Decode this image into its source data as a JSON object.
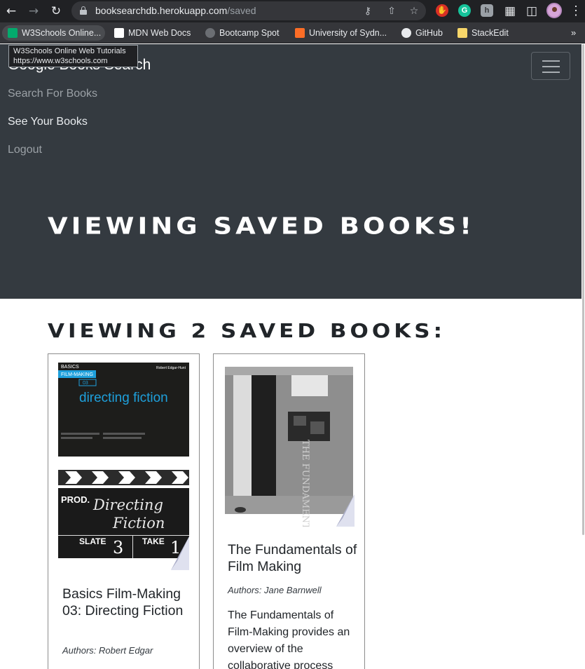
{
  "browser": {
    "url_host": "booksearchdb.herokuapp.com",
    "url_path": "/saved",
    "bookmarks": [
      {
        "label": "W3Schools Online..."
      },
      {
        "label": "MDN Web Docs"
      },
      {
        "label": "Bootcamp Spot"
      },
      {
        "label": "University of Sydn..."
      },
      {
        "label": "GitHub"
      },
      {
        "label": "StackEdit"
      }
    ],
    "tooltip": {
      "title": "W3Schools Online Web Tutorials",
      "url": "https://www.w3schools.com"
    },
    "icons": [
      "back-arrow-icon",
      "forward-arrow-icon",
      "reload-icon",
      "lock-icon",
      "key-icon",
      "share-icon",
      "star-icon",
      "puzzle-icon",
      "sidepanel-icon",
      "kebab-menu-icon",
      "chevron-double-right-icon"
    ]
  },
  "navbar": {
    "brand": "Google Books Search",
    "links": [
      "Search For Books",
      "See Your Books",
      "Logout"
    ],
    "hero_title": "VIEWING SAVED BOOKS!"
  },
  "main": {
    "section_title": "VIEWING 2 SAVED BOOKS:",
    "books": [
      {
        "title": "Basics Film-Making 03: Directing Fiction",
        "authors": "Authors: Robert Edgar",
        "cover": {
          "series": "BASICS",
          "subseries": "FILM-MAKING",
          "number": "03",
          "title": "directing fiction",
          "author": "Robert Edgar-Hunt",
          "clap_prod": "PROD.",
          "clap_title_1": "Directing",
          "clap_title_2": "Fiction",
          "clap_slate": "SLATE",
          "clap_slate_no": "3",
          "clap_take": "TAKE",
          "clap_take_no": "1"
        }
      },
      {
        "title": "The Fundamentals of Film Making",
        "authors": "Authors: Jane Barnwell",
        "description": "The Fundamentals of Film-Making provides an overview of the collaborative process",
        "cover": {
          "spine_text": "THE FUNDAMENTALS OF FILM-MAKING"
        }
      }
    ]
  },
  "colors": {
    "navbar_bg": "#343a40",
    "chrome_bg": "#202124",
    "bookmarks_bg": "#35363a",
    "cover_accent": "#1ea0dc"
  }
}
